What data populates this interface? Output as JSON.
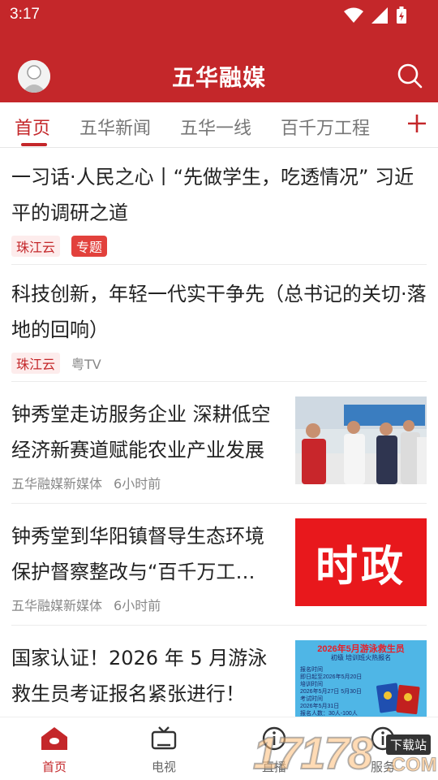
{
  "status": {
    "time": "3:17"
  },
  "app": {
    "title": "五华融媒"
  },
  "tabs": [
    {
      "label": "首页",
      "active": true
    },
    {
      "label": "五华新闻"
    },
    {
      "label": "五华一线"
    },
    {
      "label": "百千万工程"
    }
  ],
  "feed": [
    {
      "headline": "一习话·人民之心丨“先做学生，吃透情况” 习近平的调研之道",
      "source_tag": "珠江云",
      "topic_tag": "专题"
    },
    {
      "headline": "科技创新，年轻一代实干争先（总书记的关切·落地的回响）",
      "source_tag": "珠江云",
      "source": "粤TV"
    },
    {
      "headline": "钟秀堂走访服务企业 深耕低空经济新赛道赋能农业产业发展",
      "source": "五华融媒新媒体",
      "time": "6小时前",
      "thumb": "photo-officials-visit"
    },
    {
      "headline": "钟秀堂到华阳镇督导生态环境保护督察整改与“百千万工程”工作",
      "source": "五华融媒新媒体",
      "time": "6小时前",
      "thumb_text": "时政"
    },
    {
      "headline": "国家认证！2026 年 5 月游泳救生员考证报名紧张进行！",
      "thumb_poster": {
        "title": "2026年5月游泳救生员",
        "subtitle": "初级 培训班火热报名",
        "l1": "报名时间",
        "l1v": "即日起至2026年5月20日",
        "l2": "培训时间",
        "l2v": "2026年5月27日   5月30日",
        "l3": "考试时间",
        "l3v": "2026年5月31日",
        "l4": "报名人数：30人-100人"
      }
    }
  ],
  "bottom_nav": [
    {
      "label": "首页",
      "icon": "home-icon",
      "active": true
    },
    {
      "label": "电视",
      "icon": "tv-icon"
    },
    {
      "label": "直播",
      "icon": "info-icon"
    },
    {
      "label": "服务",
      "icon": "info-icon"
    }
  ],
  "watermark": {
    "number": "17178",
    "tag": "下载站",
    "domain": ".COM"
  },
  "colors": {
    "brand": "#c4272a",
    "tag_bg": "#fdecec",
    "topic_bg": "#e2413c"
  }
}
